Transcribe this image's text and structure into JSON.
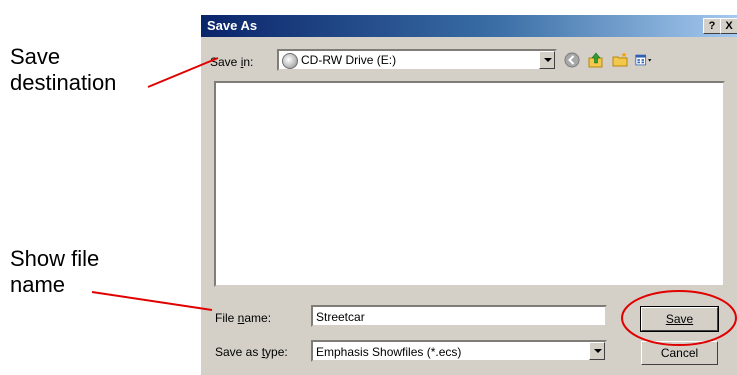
{
  "callouts": {
    "save_destination": "Save\ndestination",
    "show_file_name": "Show file\nname"
  },
  "dialog": {
    "title": "Save As",
    "help_button": "?",
    "close_button": "X",
    "save_in_label": "Save in:",
    "save_in_value": "CD-RW Drive (E:)",
    "file_name_label": "File name:",
    "file_name_value": "Streetcar",
    "save_as_type_label": "Save as type:",
    "save_as_type_value": "Emphasis Showfiles (*.ecs)",
    "save_button": "Save",
    "cancel_button": "Cancel"
  },
  "colors": {
    "callout_line": "#e00000",
    "dialog_face": "#d4d0c8",
    "title_start": "#0a246a",
    "title_end": "#a6caf0"
  },
  "icons": [
    "drive-icon",
    "back-icon",
    "up-folder-icon",
    "new-folder-icon",
    "views-icon"
  ]
}
